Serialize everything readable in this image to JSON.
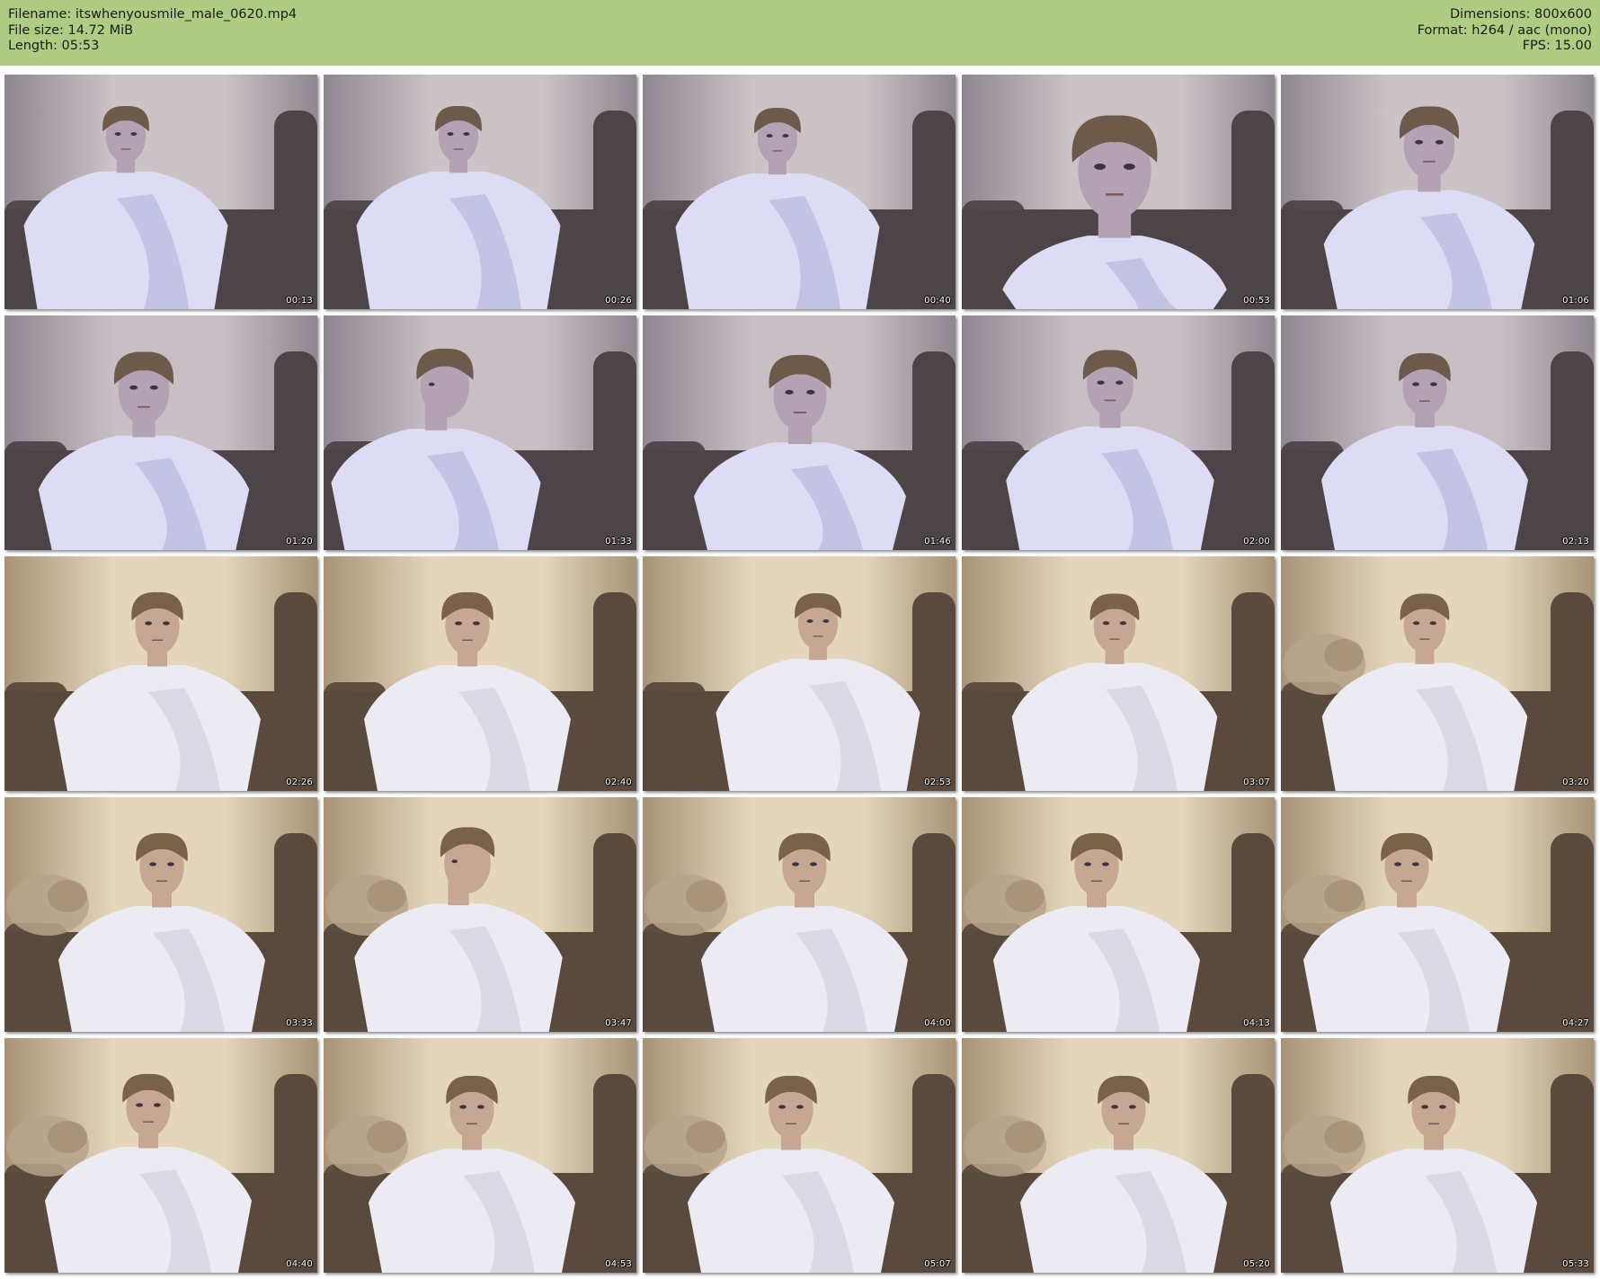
{
  "info": {
    "filename": "Filename: itswhenyousmile_male_0620.mp4",
    "file_size": "File size: 14.72 MiB",
    "length": "Length: 05:53",
    "dimensions": "Dimensions: 800x600",
    "format": "Format: h264 / aac (mono)",
    "fps": "FPS: 15.00"
  },
  "colors": {
    "header_bg": "#b0cc82",
    "page_bg": "#ffffff",
    "wall_warm": "#e8dcc2",
    "wall_cool": "#c9c2c8",
    "sofa": "#5f4f44",
    "shirt": "#e6e6f4"
  },
  "thumbnails": [
    {
      "timestamp": "00:13"
    },
    {
      "timestamp": "00:26"
    },
    {
      "timestamp": "00:40"
    },
    {
      "timestamp": "00:53"
    },
    {
      "timestamp": "01:06"
    },
    {
      "timestamp": "01:20"
    },
    {
      "timestamp": "01:33"
    },
    {
      "timestamp": "01:46"
    },
    {
      "timestamp": "02:00"
    },
    {
      "timestamp": "02:13"
    },
    {
      "timestamp": "02:26"
    },
    {
      "timestamp": "02:40"
    },
    {
      "timestamp": "02:53"
    },
    {
      "timestamp": "03:07"
    },
    {
      "timestamp": "03:20"
    },
    {
      "timestamp": "03:33"
    },
    {
      "timestamp": "03:47"
    },
    {
      "timestamp": "04:00"
    },
    {
      "timestamp": "04:13"
    },
    {
      "timestamp": "04:27"
    },
    {
      "timestamp": "04:40"
    },
    {
      "timestamp": "04:53"
    },
    {
      "timestamp": "05:07"
    },
    {
      "timestamp": "05:20"
    },
    {
      "timestamp": "05:33"
    }
  ]
}
